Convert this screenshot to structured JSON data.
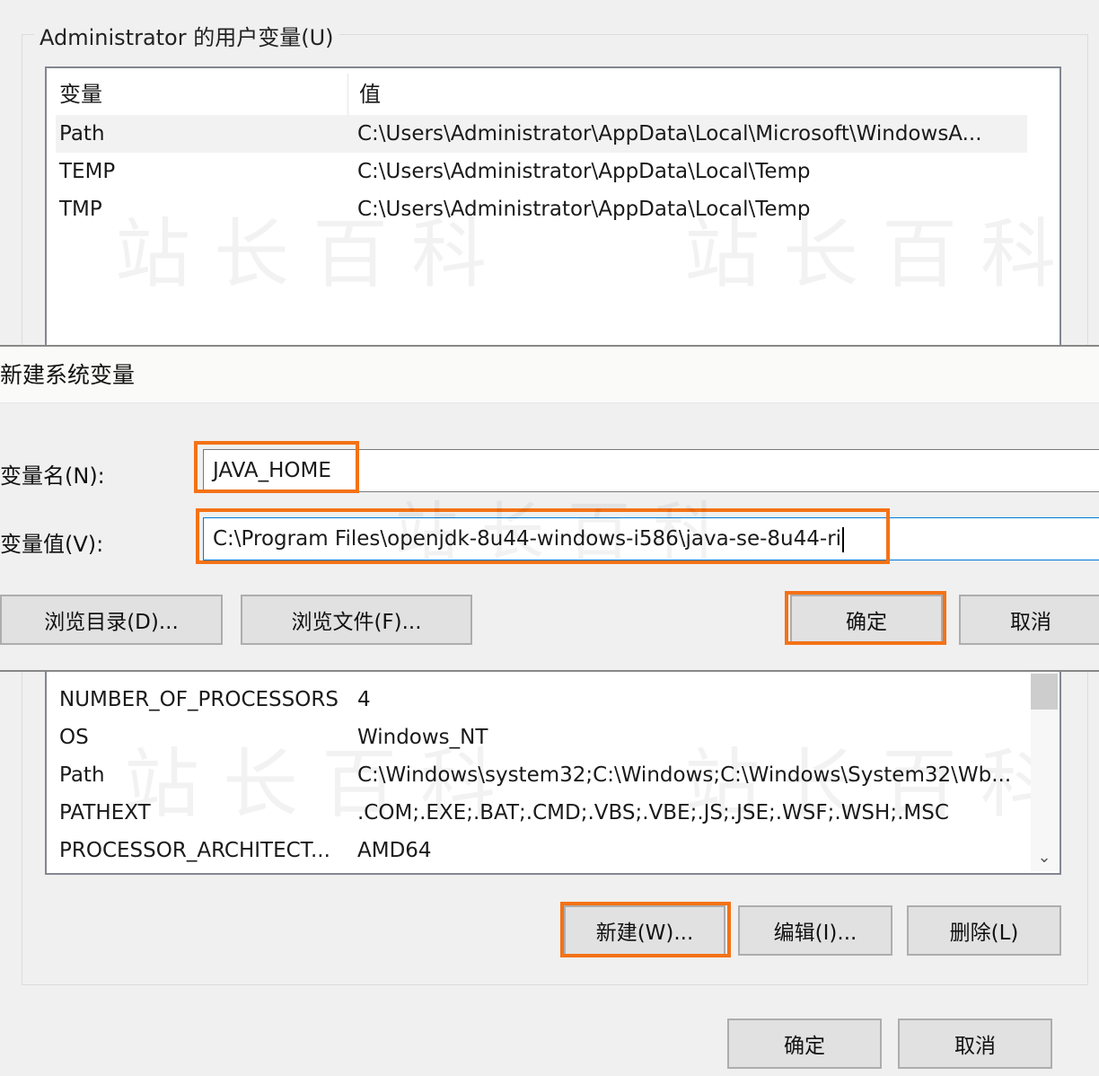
{
  "user_vars": {
    "group_title": "Administrator 的用户变量(U)",
    "header": {
      "variable": "变量",
      "value": "值"
    },
    "rows": [
      {
        "name": "Path",
        "value": "C:\\Users\\Administrator\\AppData\\Local\\Microsoft\\WindowsA..."
      },
      {
        "name": "TEMP",
        "value": "C:\\Users\\Administrator\\AppData\\Local\\Temp"
      },
      {
        "name": "TMP",
        "value": "C:\\Users\\Administrator\\AppData\\Local\\Temp"
      }
    ]
  },
  "new_var_dialog": {
    "title": "新建系统变量",
    "name_label": "变量名(N):",
    "name_value": "JAVA_HOME",
    "value_label": "变量值(V):",
    "value_value": "C:\\Program Files\\openjdk-8u44-windows-i586\\java-se-8u44-ri",
    "browse_dir": "浏览目录(D)...",
    "browse_file": "浏览文件(F)...",
    "ok": "确定",
    "cancel": "取消"
  },
  "system_vars": {
    "rows": [
      {
        "name": "NUMBER_OF_PROCESSORS",
        "value": "4"
      },
      {
        "name": "OS",
        "value": "Windows_NT"
      },
      {
        "name": "Path",
        "value": "C:\\Windows\\system32;C:\\Windows;C:\\Windows\\System32\\Wb..."
      },
      {
        "name": "PATHEXT",
        "value": ".COM;.EXE;.BAT;.CMD;.VBS;.VBE;.JS;.JSE;.WSF;.WSH;.MSC"
      },
      {
        "name": "PROCESSOR_ARCHITECT...",
        "value": "AMD64"
      }
    ],
    "new_button": "新建(W)...",
    "edit_button": "编辑(I)...",
    "delete_button": "删除(L)"
  },
  "footer": {
    "ok": "确定",
    "cancel": "取消"
  },
  "watermark": "站长百科",
  "colors": {
    "highlight": "#f47216",
    "window_bg": "#f0f0f0",
    "list_border": "#828790"
  }
}
